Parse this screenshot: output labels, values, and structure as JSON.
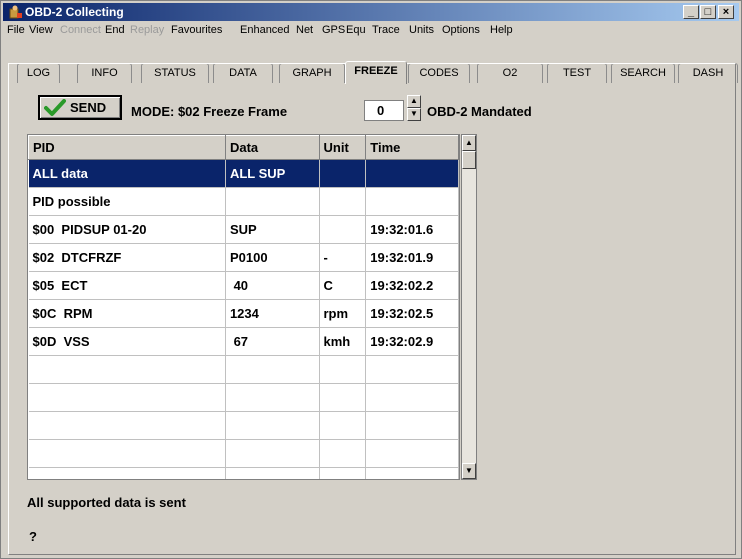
{
  "window": {
    "title": "OBD-2 Collecting"
  },
  "menu": [
    "File",
    "View",
    "Connect",
    "End",
    "Replay",
    "Favourites",
    "Enhanced",
    "Net",
    "GPS",
    "Equ",
    "Trace",
    "Units",
    "Options",
    "Help"
  ],
  "tabs": [
    "LOG",
    "INFO",
    "STATUS",
    "DATA",
    "GRAPH",
    "FREEZE",
    "CODES",
    "O2",
    "TEST",
    "SEARCH",
    "DASH"
  ],
  "toolbar": {
    "send_label": "SEND",
    "mode_label": "MODE: $02 Freeze Frame",
    "frame_value": "0",
    "mandate_label": "OBD-2 Mandated"
  },
  "table": {
    "headers": [
      "PID",
      "Data",
      "Unit",
      "Time"
    ],
    "rows": [
      [
        "ALL data",
        "ALL SUP",
        "",
        ""
      ],
      [
        "PID possible",
        "",
        "",
        ""
      ],
      [
        "$00  PIDSUP 01-20",
        "SUP",
        "",
        "19:32:01.6"
      ],
      [
        "$02  DTCFRZF",
        "P0100",
        "-",
        "19:32:01.9"
      ],
      [
        "$05  ECT",
        " 40",
        "C",
        "19:32:02.2"
      ],
      [
        "$0C  RPM",
        "1234",
        "rpm",
        "19:32:02.5"
      ],
      [
        "$0D  VSS",
        " 67",
        "kmh",
        "19:32:02.9"
      ],
      [
        "",
        "",
        "",
        ""
      ],
      [
        "",
        "",
        "",
        ""
      ],
      [
        "",
        "",
        "",
        ""
      ],
      [
        "",
        "",
        "",
        ""
      ],
      [
        "",
        "",
        "",
        ""
      ]
    ],
    "selected_row": 0
  },
  "status": {
    "line1": "All supported data is sent",
    "line2": "?"
  }
}
